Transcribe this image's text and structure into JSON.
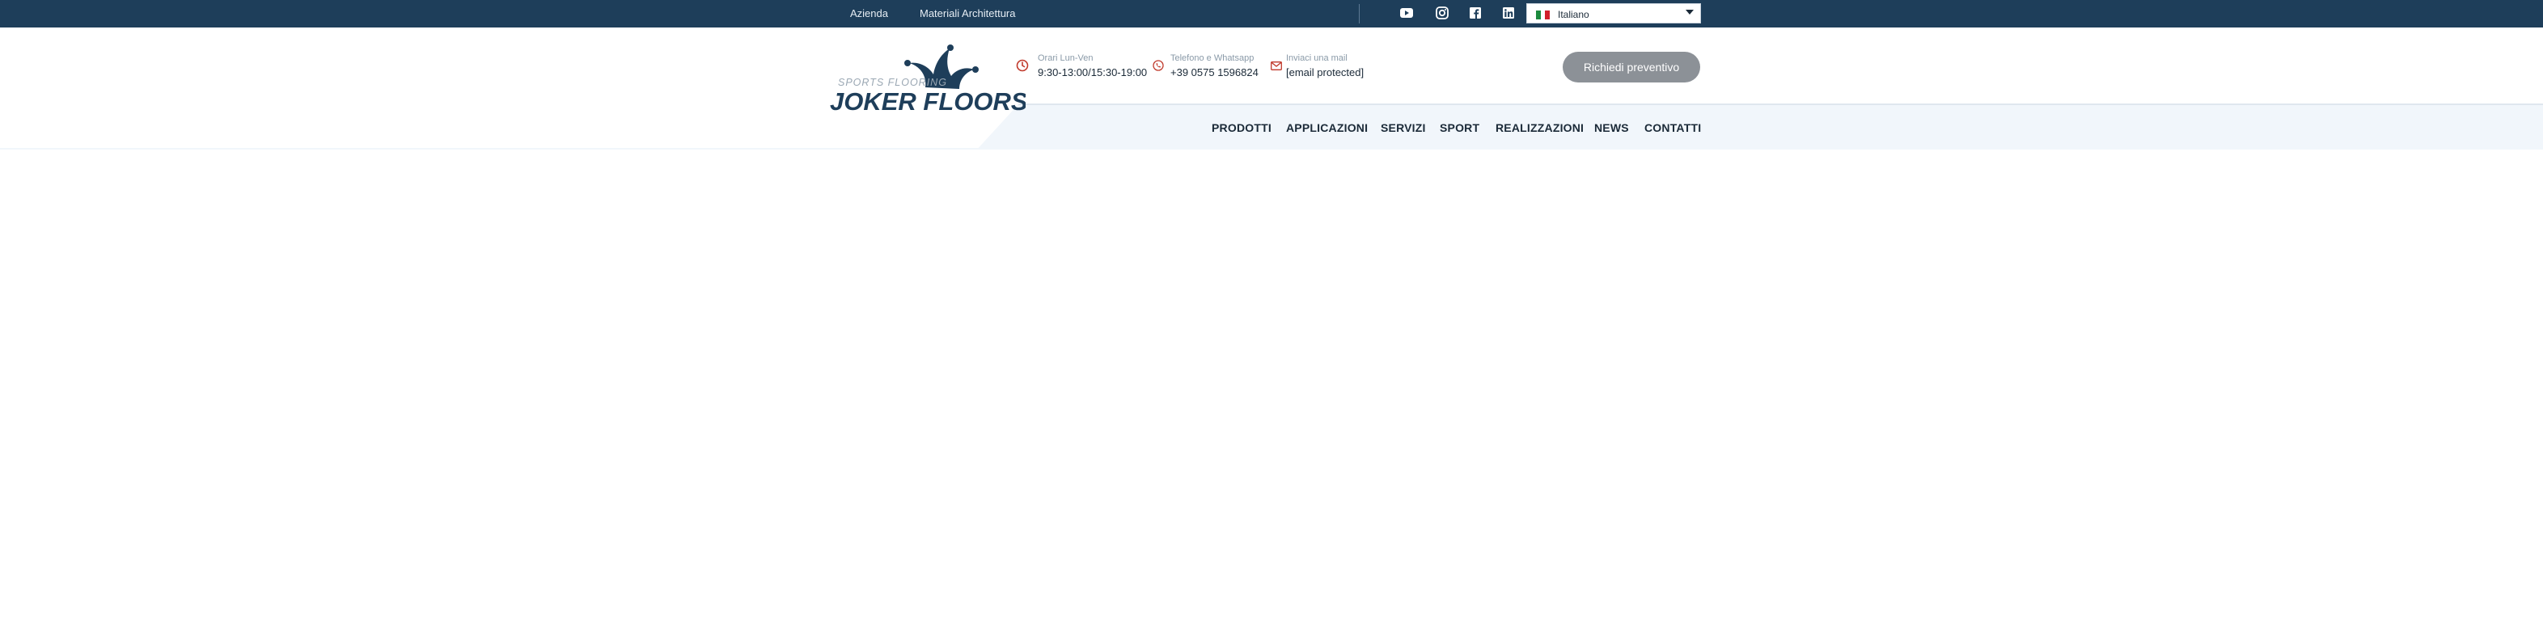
{
  "topbar": {
    "links": [
      "Azienda",
      "Materiali Architettura"
    ],
    "social_icons": [
      "youtube-icon",
      "instagram-icon",
      "facebook-icon",
      "linkedin-icon"
    ],
    "language": "Italiano",
    "colors": {
      "background": "#1e3e5a",
      "text": "#e6edf4"
    }
  },
  "logo": {
    "tagline": "SPORTS FLOORING",
    "brand": "JOKER FLOORS"
  },
  "contact": {
    "hours": {
      "label": "Orari Lun-Ven",
      "value": "9:30-13:00/15:30-19:00",
      "icon": "clock-icon"
    },
    "phone": {
      "label": "Telefono e Whatsapp",
      "value": "+39 0575 1596824",
      "icon": "phone-icon"
    },
    "email": {
      "label": "Inviaci una mail",
      "value": "[email protected]",
      "icon": "mail-icon"
    }
  },
  "cta": {
    "label": "Richiedi preventivo",
    "color": "#8c9197"
  },
  "nav": [
    "PRODOTTI",
    "APPLICAZIONI",
    "SERVIZI",
    "SPORT",
    "REALIZZAZIONI",
    "NEWS",
    "CONTATTI"
  ],
  "colors": {
    "accent": "#c0392b",
    "brand_navy": "#1e3e5a",
    "nav_band": "#f1f6fb"
  }
}
